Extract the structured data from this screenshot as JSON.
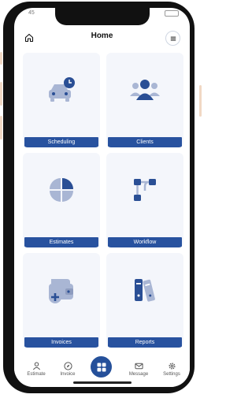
{
  "header": {
    "title": "Home"
  },
  "status": {
    "time": "45"
  },
  "cards": [
    {
      "label": "Scheduling",
      "icon": "car-clock-icon"
    },
    {
      "label": "Clients",
      "icon": "users-icon"
    },
    {
      "label": "Estimates",
      "icon": "pie-chart-icon"
    },
    {
      "label": "Workflow",
      "icon": "workflow-icon"
    },
    {
      "label": "Invoices",
      "icon": "wallet-add-icon"
    },
    {
      "label": "Reports",
      "icon": "binders-icon"
    }
  ],
  "nav": [
    {
      "label": "Estimate",
      "icon": "person-icon"
    },
    {
      "label": "Invoice",
      "icon": "compass-icon"
    },
    {
      "label": "Message",
      "icon": "mail-icon"
    },
    {
      "label": "Settings",
      "icon": "gear-icon"
    }
  ],
  "colors": {
    "brand": "#28529f",
    "icon_light": "#a9b6d4",
    "icon_dark": "#2a4f95",
    "card_bg": "#f4f6fb"
  }
}
